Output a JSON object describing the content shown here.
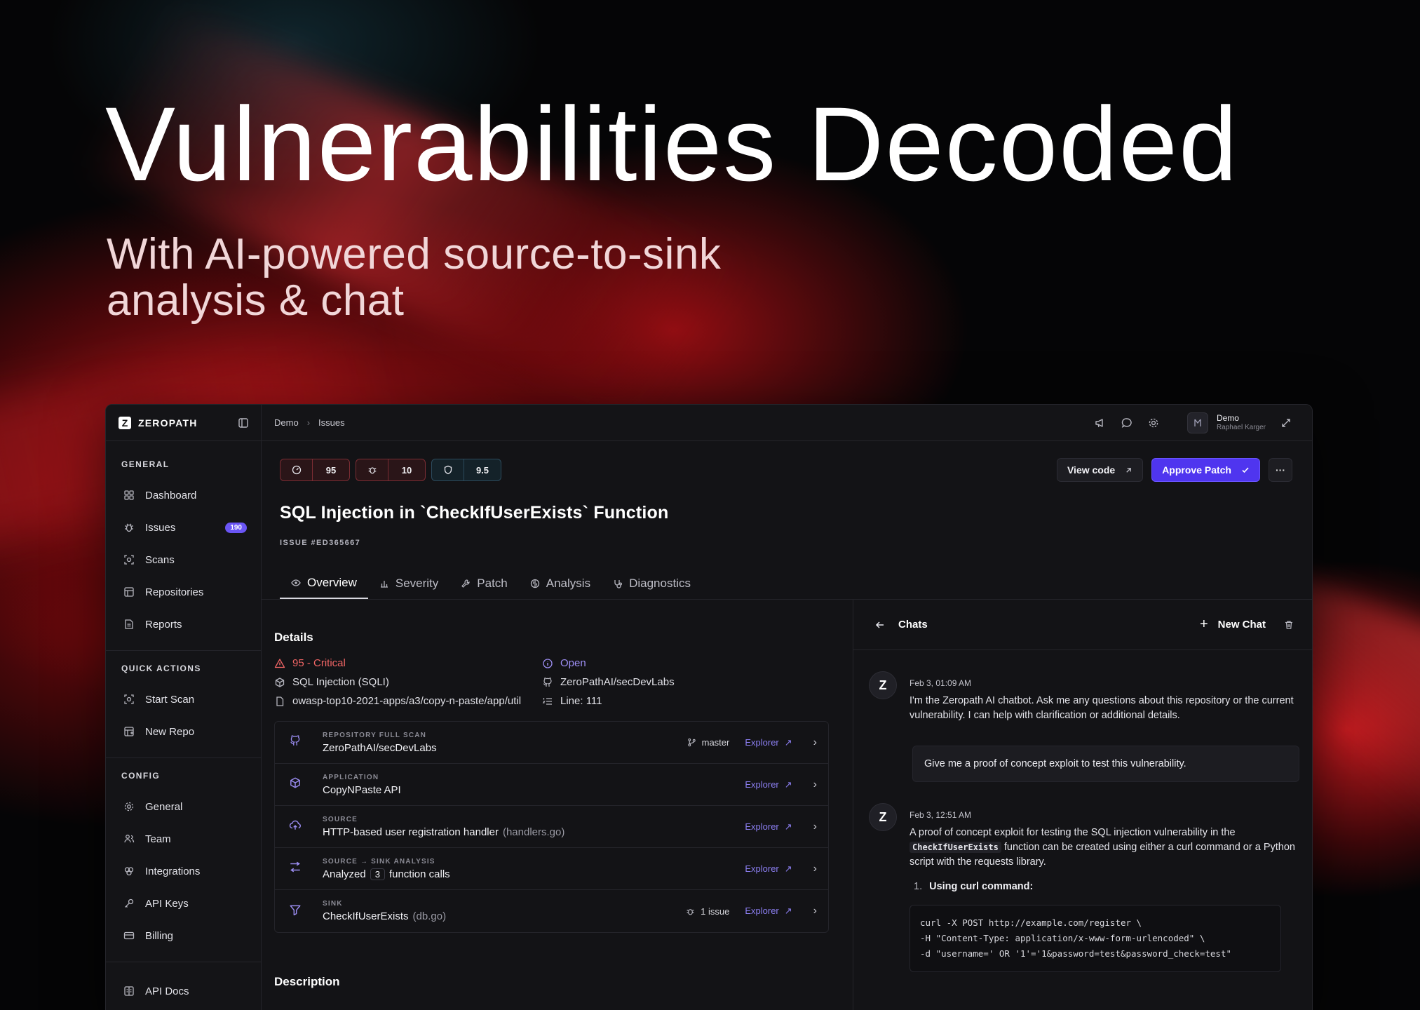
{
  "hero": {
    "title": "Vulnerabilities Decoded",
    "subtitle_line1": "With AI-powered source-to-sink",
    "subtitle_line2": "analysis & chat"
  },
  "app": {
    "brand": "ZEROPATH",
    "breadcrumbs": [
      "Demo",
      "Issues"
    ],
    "user": {
      "name": "Demo",
      "sub": "Raphael Karger"
    }
  },
  "sidebar": {
    "general_title": "GENERAL",
    "general": [
      {
        "label": "Dashboard",
        "icon": "grid-icon"
      },
      {
        "label": "Issues",
        "icon": "bug-icon",
        "badge": "190"
      },
      {
        "label": "Scans",
        "icon": "scan-icon"
      },
      {
        "label": "Repositories",
        "icon": "table-icon"
      },
      {
        "label": "Reports",
        "icon": "report-icon"
      }
    ],
    "quick_title": "QUICK ACTIONS",
    "quick": [
      {
        "label": "Start Scan",
        "icon": "scan-icon"
      },
      {
        "label": "New Repo",
        "icon": "plus-grid-icon"
      }
    ],
    "config_title": "CONFIG",
    "config": [
      {
        "label": "General",
        "icon": "gear-icon"
      },
      {
        "label": "Team",
        "icon": "team-icon"
      },
      {
        "label": "Integrations",
        "icon": "integrations-icon"
      },
      {
        "label": "API Keys",
        "icon": "key-icon"
      },
      {
        "label": "Billing",
        "icon": "card-icon"
      }
    ],
    "docs": {
      "label": "API Docs",
      "icon": "book-icon"
    }
  },
  "issue": {
    "scores": [
      "95",
      "10",
      "9.5"
    ],
    "view_code": "View code",
    "approve": "Approve Patch",
    "title": "SQL Injection in `CheckIfUserExists` Function",
    "id": "ISSUE #ED365667",
    "tabs": [
      "Overview",
      "Severity",
      "Patch",
      "Analysis",
      "Diagnostics"
    ]
  },
  "details": {
    "title": "Details",
    "severity": "95 - Critical",
    "status": "Open",
    "type": "SQL Injection (SQLI)",
    "repo": "ZeroPathAI/secDevLabs",
    "path": "owasp-top10-2021-apps/a3/copy-n-paste/app/util",
    "line": "Line: 111"
  },
  "rows": [
    {
      "label": "REPOSITORY FULL SCAN",
      "value": "ZeroPathAI/secDevLabs",
      "meta": "master",
      "link": "Explorer"
    },
    {
      "label": "APPLICATION",
      "value": "CopyNPaste API",
      "link": "Explorer"
    },
    {
      "label": "SOURCE",
      "value": "HTTP-based user registration handler",
      "muted": "(handlers.go)",
      "link": "Explorer"
    },
    {
      "label": "SOURCE → SINK ANALYSIS",
      "pre": "Analyzed",
      "chip": "3",
      "post": "function calls",
      "link": "Explorer"
    },
    {
      "label": "SINK",
      "value": "CheckIfUserExists",
      "muted": "(db.go)",
      "meta": "1 issue",
      "link": "Explorer"
    }
  ],
  "description_title": "Description",
  "chat": {
    "title": "Chats",
    "new_chat": "New Chat",
    "m1_time": "Feb 3, 01:09 AM",
    "m1_text": "I'm the Zeropath AI chatbot. Ask me any questions about this repository or the current vulnerability. I can help with clarification or additional details.",
    "user_msg": "Give me a proof of concept exploit to test this vulnerability.",
    "m2_time": "Feb 3, 12:51 AM",
    "m2_pre": "A proof of concept exploit for testing the SQL injection vulnerability in the",
    "m2_code": "CheckIfUserExists",
    "m2_post": "function can be created using either a curl command or a Python script with the requests library.",
    "step1_num": "1.",
    "step1": "Using curl command:",
    "code": "curl -X POST http://example.com/register \\\n-H \"Content-Type: application/x-www-form-urlencoded\" \\\n-d \"username=' OR '1'='1&password=test&password_check=test\""
  }
}
